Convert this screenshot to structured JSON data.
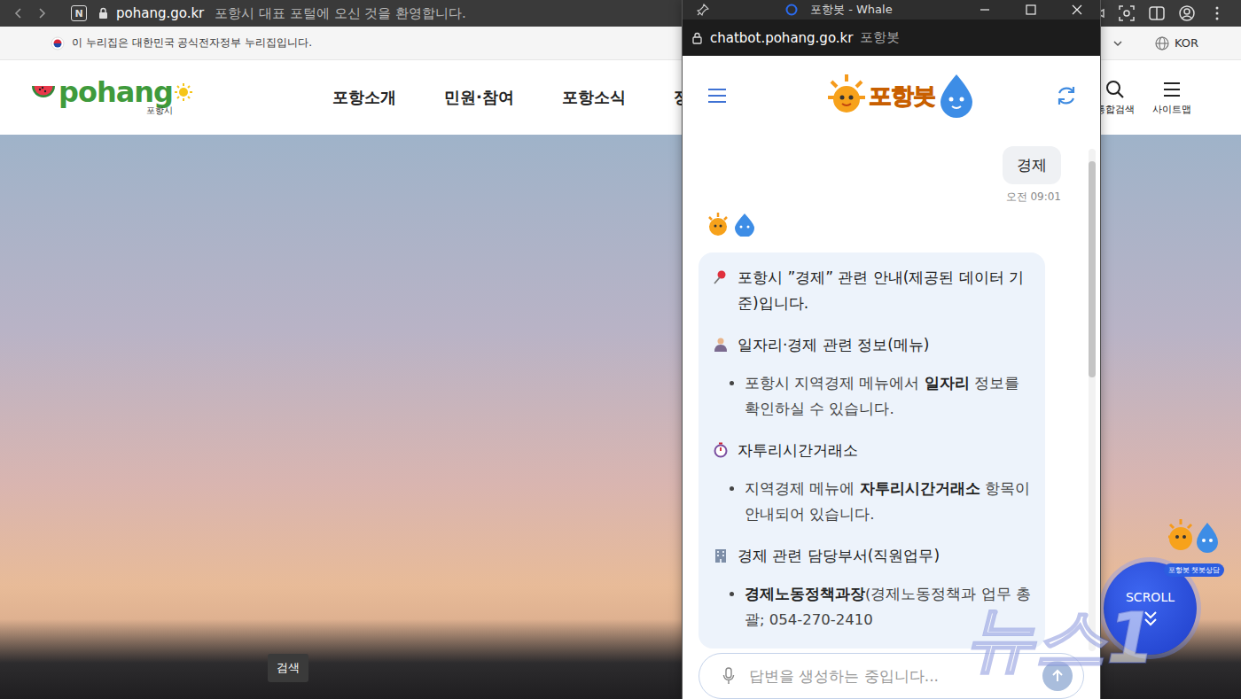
{
  "browser": {
    "app_icon": "N",
    "url": "pohang.go.kr",
    "page_title": "포항시 대표 포털에 오신 것을 환영합니다."
  },
  "gov_banner": {
    "text": "이 누리집은 대한민국 공식전자정부 누리집입니다.",
    "language": "KOR"
  },
  "site_header": {
    "logo": "pohang",
    "logo_sub": "포항시",
    "nav": [
      {
        "label": "포항소개"
      },
      {
        "label": "민원·참여"
      },
      {
        "label": "포항소식"
      },
      {
        "label": "정"
      }
    ],
    "tools": [
      {
        "label": "통합검색",
        "kind": "search"
      },
      {
        "label": "사이트맵",
        "kind": "menu"
      }
    ]
  },
  "hero": {
    "tooltip": "검색"
  },
  "floating": {
    "chatbot_badge": "포항봇 챗봇상담",
    "scroll_button": "SCROLL"
  },
  "watermark": "뉴스1",
  "popup": {
    "title": "포항봇 - Whale",
    "url": "chatbot.pohang.go.kr",
    "page_title": "포항봇",
    "logo": "포항봇",
    "user_message": {
      "text": "경제",
      "time": "오전 09:01"
    },
    "bot_message": {
      "intro": "포항시 ”경제” 관련 안내(제공된 데이터 기준)입니다.",
      "sections": [
        {
          "kind": "person",
          "heading": "일자리·경제 관련 정보(메뉴)",
          "bullets": [
            [
              {
                "text": "포항시 지역경제 메뉴에서 ",
                "bold": false
              },
              {
                "text": "일자리",
                "bold": true
              },
              {
                "text": " 정보를 확인하실 수 있습니다.",
                "bold": false
              }
            ]
          ]
        },
        {
          "kind": "timer",
          "heading": "자투리시간거래소",
          "bullets": [
            [
              {
                "text": "지역경제 메뉴에 ",
                "bold": false
              },
              {
                "text": "자투리시간거래소",
                "bold": true
              },
              {
                "text": " 항목이 안내되어 있습니다.",
                "bold": false
              }
            ]
          ]
        },
        {
          "kind": "building",
          "heading": "경제 관련 담당부서(직원업무)",
          "bullets": [
            [
              {
                "text": "경제노동정책과장",
                "bold": true
              },
              {
                "text": "(경제노동정책과 업무 총괄; 054-270-2410",
                "bold": false
              }
            ]
          ]
        }
      ]
    },
    "input": {
      "placeholder": "답변을 생성하는 중입니다..."
    },
    "scrollbar": {
      "level": 0.43
    }
  }
}
